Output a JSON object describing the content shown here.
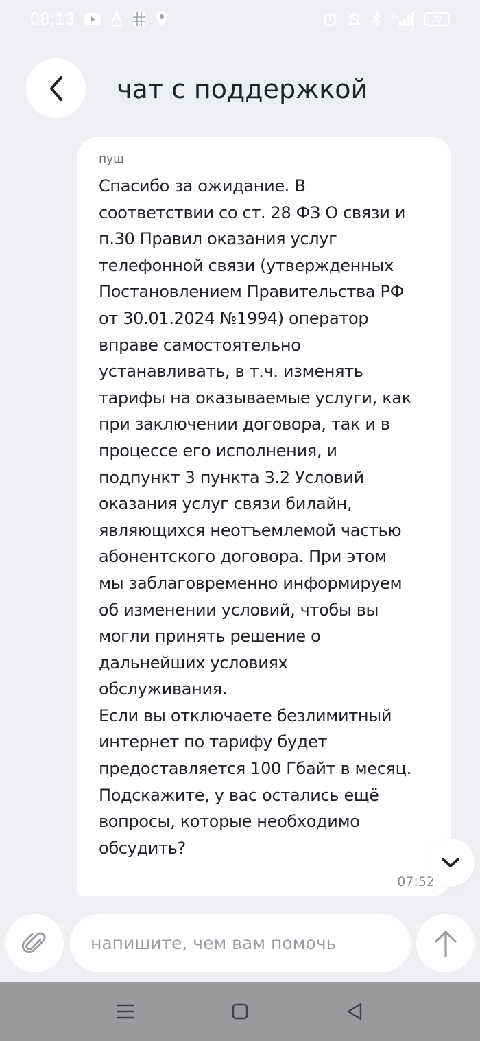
{
  "status_bar": {
    "time": "08:13",
    "battery": "79",
    "icons": [
      "youtube-icon",
      "font-icon",
      "app-grid-icon",
      "location-icon",
      "alarm-icon",
      "mute-icon",
      "bluetooth-icon",
      "signal-icon",
      "battery-icon"
    ]
  },
  "header": {
    "title": "чат с поддержкой",
    "back_icon": "chevron-left-icon"
  },
  "message": {
    "sender": "пуш",
    "lines": [
      "Спасибо за ожидание. В",
      "соответствии со ст. 28 ФЗ О связи и",
      "п.30  Правил оказания услуг",
      "телефонной связи (утвержденных",
      "Постановлением Правительства РФ",
      "от 30.01.2024 №1994) оператор",
      "вправе самостоятельно",
      "устанавливать, в т.ч. изменять",
      "тарифы на оказываемые услуги, как",
      "при заключении договора, так и в",
      "процессе его исполнения, и",
      "подпункт 3 пункта 3.2 Условий",
      "оказания услуг связи билайн,",
      "являющихся неотъемлемой частью",
      "абонентского договора. При этом",
      "мы заблаговременно информируем",
      "об изменении условий, чтобы вы",
      "могли принять решение о",
      "дальнейших условиях",
      "обслуживания.",
      "Если вы отключаете безлимитный",
      "интернет по тарифу будет",
      "предоставляется 100 Гбайт в месяц.",
      "Подскажите, у вас остались ещё",
      "вопросы, которые необходимо",
      "обсудить?"
    ],
    "time": "07:52"
  },
  "composer": {
    "placeholder": "напишите, чем вам помочь",
    "value": "",
    "attach_icon": "paperclip-icon",
    "send_icon": "arrow-up-icon"
  },
  "scroll_button_icon": "chevron-down-icon",
  "nav": {
    "icons": [
      "menu-icon",
      "home-square-icon",
      "back-triangle-icon"
    ]
  },
  "colors": {
    "background": "#edeff3",
    "bubble": "#ffffff",
    "text": "#1f2229",
    "muted": "#8a8d95",
    "nav_bar": "#9a9a9c"
  }
}
